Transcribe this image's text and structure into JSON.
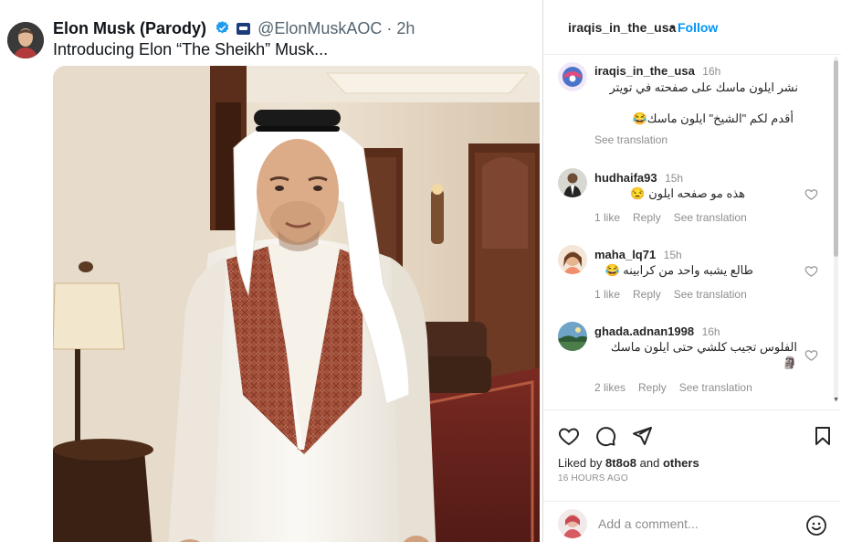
{
  "tweet": {
    "name": "Elon Musk (Parody)",
    "handle": "@ElonMuskAOC",
    "separator": "·",
    "time": "2h",
    "text": "Introducing Elon “The Sheikh” Musk..."
  },
  "panel": {
    "header": {
      "username": "iraqis_in_the_usa",
      "dot": "•",
      "follow_label": "Follow",
      "more_icon": "more-horizontal-icon"
    },
    "caption": {
      "username": "iraqis_in_the_usa",
      "time": "16h",
      "line1": "نشر ايلون ماسك على صفحته في تويتر",
      "line2": "أقدم لكم \"الشيخ\" ايلون ماسك😂",
      "see_translation": "See translation"
    },
    "comments": [
      {
        "username": "hudhaifa93",
        "time": "15h",
        "text": "هذه مو صفحه ايلون 😒",
        "likes": "1 like",
        "reply": "Reply",
        "see_translation": "See translation"
      },
      {
        "username": "maha_lq71",
        "time": "15h",
        "text": "طالع يشبه واحد من كرابينه 😂",
        "likes": "1 like",
        "reply": "Reply",
        "see_translation": "See translation"
      },
      {
        "username": "ghada.adnan1998",
        "time": "16h",
        "text": "الفلوس تجيب كلشي حتى ايلون ماسك",
        "text2": "🗿",
        "likes": "2 likes",
        "reply": "Reply",
        "see_translation": "See translation"
      }
    ],
    "actions": {
      "liked_by_prefix": "Liked by ",
      "liked_by_user": "8t8o8",
      "liked_by_mid": " and ",
      "liked_by_others": "others",
      "age": "16 HOURS AGO"
    },
    "add_comment": {
      "placeholder": "Add a comment..."
    }
  },
  "colors": {
    "accent": "#0095f6",
    "muted": "#8e8e8e",
    "twitter_verified": "#1d9bf0"
  }
}
